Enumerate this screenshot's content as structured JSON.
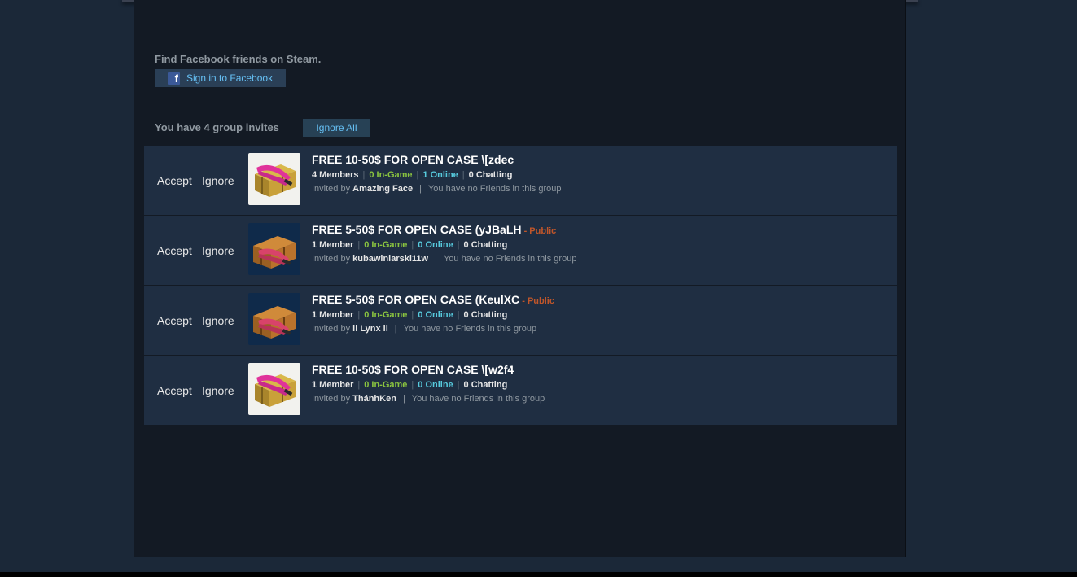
{
  "facebook": {
    "title": "Find Facebook friends on Steam.",
    "sign_in_label": "Sign in to Facebook",
    "icon": "facebook-icon"
  },
  "invites": {
    "title": "You have 4 group invites",
    "ignore_all_label": "Ignore All",
    "items": [
      {
        "accept_label": "Accept",
        "ignore_label": "Ignore",
        "avatar": "case-icon-gold",
        "name": "FREE 10-50$ FOR OPEN CASE \\[zdec",
        "public_tag": "",
        "members": "4 Members",
        "ingame": "0 In-Game",
        "online": "1 Online",
        "chatting": "0 Chatting",
        "invited_by_prefix": "Invited by",
        "inviter": "Amazing Face",
        "friends_note": "You have no Friends in this group"
      },
      {
        "accept_label": "Accept",
        "ignore_label": "Ignore",
        "avatar": "case-icon-blue",
        "name": "FREE 5-50$ FOR OPEN CASE (yJBaLH",
        "public_tag": " - Public",
        "members": "1 Member",
        "ingame": "0 In-Game",
        "online": "0 Online",
        "chatting": "0 Chatting",
        "invited_by_prefix": "Invited by",
        "inviter": "kubawiniarski11w",
        "friends_note": "You have no Friends in this group"
      },
      {
        "accept_label": "Accept",
        "ignore_label": "Ignore",
        "avatar": "case-icon-blue",
        "name": "FREE 5-50$ FOR OPEN CASE (KeulXC",
        "public_tag": " - Public",
        "members": "1 Member",
        "ingame": "0 In-Game",
        "online": "0 Online",
        "chatting": "0 Chatting",
        "invited_by_prefix": "Invited by",
        "inviter": "ll Lynx ll",
        "friends_note": "You have no Friends in this group"
      },
      {
        "accept_label": "Accept",
        "ignore_label": "Ignore",
        "avatar": "case-icon-gold",
        "name": "FREE 10-50$ FOR OPEN CASE \\[w2f4",
        "public_tag": "",
        "members": "1 Member",
        "ingame": "0 In-Game",
        "online": "0 Online",
        "chatting": "0 Chatting",
        "invited_by_prefix": "Invited by",
        "inviter": "ThánhKen",
        "friends_note": "You have no Friends in this group"
      }
    ]
  },
  "colors": {
    "page_bg": "#1b2838",
    "panel_bg": "#131a24",
    "row_bg": "#1f2e42",
    "in_game": "#8bc53f",
    "online": "#57cbde",
    "public": "#c0562a",
    "link": "#66c0f4"
  }
}
